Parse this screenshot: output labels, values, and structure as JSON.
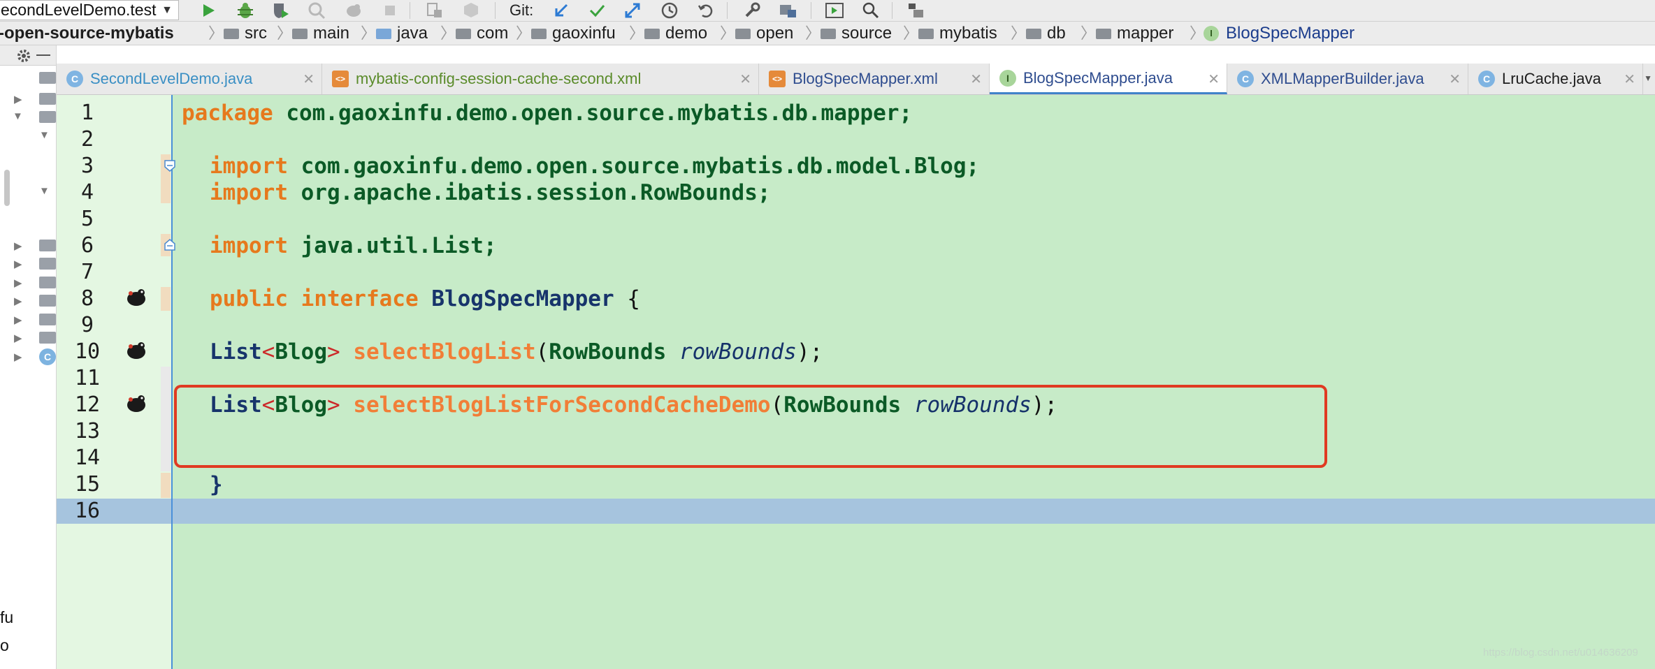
{
  "toolbar": {
    "run_config": "econdLevelDemo.test",
    "git_label": "Git:"
  },
  "breadcrumb": {
    "project": "-open-source-mybatis",
    "items": [
      "src",
      "main",
      "java",
      "com",
      "gaoxinfu",
      "demo",
      "open",
      "source",
      "mybatis",
      "db",
      "mapper"
    ],
    "current": "BlogSpecMapper"
  },
  "tabs": [
    {
      "label": "SecondLevelDemo.java",
      "icon": "class-icon",
      "color": "#3a8fc4",
      "active": false
    },
    {
      "label": "mybatis-config-session-cache-second.xml",
      "icon": "xml-icon",
      "color": "#5a8b2a",
      "active": false
    },
    {
      "label": "BlogSpecMapper.xml",
      "icon": "xml-icon",
      "color": "#2f4d8f",
      "active": false
    },
    {
      "label": "BlogSpecMapper.java",
      "icon": "interface-icon",
      "color": "#2f4d8f",
      "active": true
    },
    {
      "label": "XMLMapperBuilder.java",
      "icon": "class-icon",
      "color": "#2f4d8f",
      "active": false
    },
    {
      "label": "LruCache.java",
      "icon": "class-icon",
      "color": "#1d1d1d",
      "active": false
    }
  ],
  "editor": {
    "line_numbers": [
      "1",
      "2",
      "3",
      "4",
      "5",
      "6",
      "7",
      "8",
      "9",
      "10",
      "11",
      "12",
      "13",
      "14",
      "15",
      "16"
    ],
    "lines": {
      "l1": {
        "kw": "package",
        "rest": " com.gaoxinfu.demo.open.source.mybatis.db.mapper;"
      },
      "l3": {
        "kw": "import",
        "rest": " com.gaoxinfu.demo.open.source.mybatis.db.model.Blog;"
      },
      "l4": {
        "kw": "import",
        "rest": " org.apache.ibatis.session.RowBounds;"
      },
      "l6": {
        "kw": "import",
        "rest": " java.util.List;"
      },
      "l8": {
        "kw1": "public",
        "kw2": "interface",
        "name": "BlogSpecMapper",
        "brace": " {"
      },
      "l10": {
        "type": "List",
        "generic": "Blog",
        "method": "selectBlogList",
        "ptype": "RowBounds",
        "pname": "rowBounds"
      },
      "l12": {
        "type": "List",
        "generic": "Blog",
        "method": "selectBlogListForSecondCacheDemo",
        "ptype": "RowBounds",
        "pname": "rowBounds"
      },
      "l15": {
        "brace": "}"
      }
    }
  },
  "sidebar": {
    "partial_labels": [
      "fu",
      "o"
    ]
  },
  "watermark": "https://blog.csdn.net/u014636209"
}
